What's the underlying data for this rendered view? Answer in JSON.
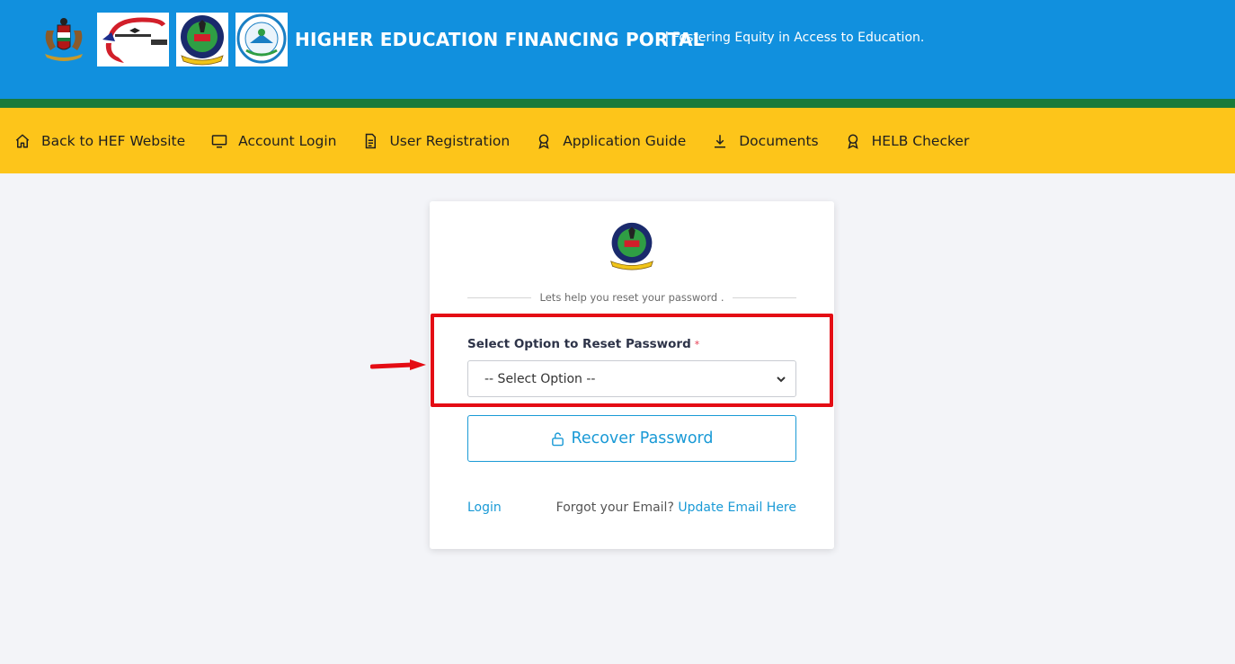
{
  "header": {
    "title": "HIGHER EDUCATION FINANCING PORTAL",
    "separator": "|",
    "tagline": "Fostering Equity in Access to Education.",
    "colors": {
      "blue": "#1190de",
      "green": "#1a7a3a",
      "yellow": "#fdc51a"
    }
  },
  "logos": [
    {
      "icon": "kenya-coat-of-arms-icon"
    },
    {
      "icon": "ministry-of-education-logo-icon"
    },
    {
      "icon": "helb-logo-icon"
    },
    {
      "icon": "universities-fund-logo-icon"
    }
  ],
  "nav": {
    "items": [
      {
        "label": "Back to HEF Website",
        "icon": "home-icon"
      },
      {
        "label": "Account Login",
        "icon": "monitor-icon"
      },
      {
        "label": "User Registration",
        "icon": "document-icon"
      },
      {
        "label": "Application Guide",
        "icon": "award-icon"
      },
      {
        "label": "Documents",
        "icon": "download-icon"
      },
      {
        "label": "HELB Checker",
        "icon": "award-icon"
      }
    ]
  },
  "card": {
    "subtitle": "Lets help you reset your password .",
    "field_label": "Select Option to Reset Password",
    "required_mark": "*",
    "select_value": "-- Select Option --",
    "recover_label": "Recover Password",
    "login_label": "Login",
    "forgot_text": "Forgot your Email?",
    "update_label": "Update Email Here"
  },
  "annotation": {
    "highlight_color": "#e40c14",
    "arrow_icon": "arrow-right-icon"
  }
}
